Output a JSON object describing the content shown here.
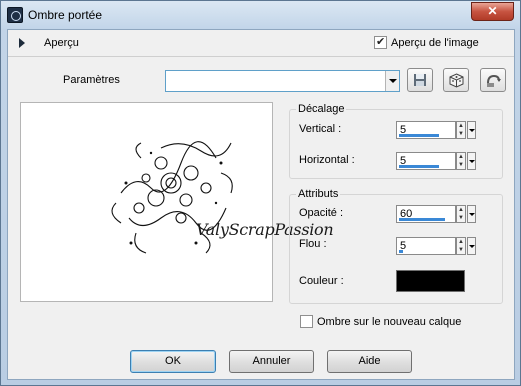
{
  "window": {
    "title": "Ombre portée",
    "close_glyph": "✕"
  },
  "preview_bar": {
    "label": "Aperçu",
    "image_preview_label": "Aperçu de l'image",
    "image_preview_checked": true
  },
  "params": {
    "label": "Paramètres",
    "value": ""
  },
  "preview": {
    "watermark": "ValyScrapPassion"
  },
  "decalage": {
    "title": "Décalage",
    "vertical": {
      "label": "Vertical :",
      "value": "5"
    },
    "horizontal": {
      "label": "Horizontal :",
      "value": "5"
    }
  },
  "attributs": {
    "title": "Attributs",
    "opacite": {
      "label": "Opacité :",
      "value": "60"
    },
    "flou": {
      "label": "Flou :",
      "value": "5"
    },
    "couleur": {
      "label": "Couleur :",
      "color": "#000000"
    }
  },
  "new_layer": {
    "label": "Ombre sur le nouveau calque",
    "checked": false
  },
  "buttons": {
    "ok": "OK",
    "cancel": "Annuler",
    "help": "Aide"
  },
  "icons": [
    "app-icon",
    "save-icon",
    "preset-icon",
    "reset-icon",
    "expand-arrow-icon"
  ]
}
